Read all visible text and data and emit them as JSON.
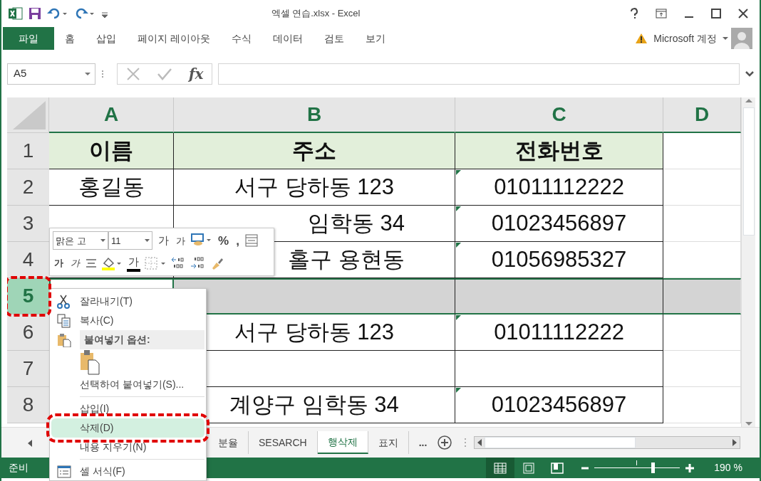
{
  "window": {
    "title": "엑셀 연습.xlsx - Excel"
  },
  "file_tab": "파일",
  "ribbon_tabs": [
    "홈",
    "삽입",
    "페이지 레이아웃",
    "수식",
    "데이터",
    "검토",
    "보기"
  ],
  "account": {
    "label": "Microsoft 계정"
  },
  "formula_bar": {
    "name_box": "A5",
    "fx": "fx"
  },
  "grid": {
    "columns": [
      {
        "label": "A",
        "selected": true
      },
      {
        "label": "B",
        "selected": true
      },
      {
        "label": "C",
        "selected": true
      },
      {
        "label": "D",
        "selected": true
      }
    ],
    "rows": [
      {
        "header": "1",
        "kind": "header",
        "selected": false,
        "marked": false,
        "cells": [
          {
            "text": "이름"
          },
          {
            "text": "주소"
          },
          {
            "text": "전화번호"
          },
          {}
        ]
      },
      {
        "header": "2",
        "kind": "data",
        "selected": false,
        "marked": false,
        "cells": [
          {
            "text": "홍길동"
          },
          {
            "text": "서구 당하동 123"
          },
          {
            "text": "01011112222",
            "flag": true
          },
          {}
        ]
      },
      {
        "header": "3",
        "kind": "data",
        "selected": false,
        "marked": false,
        "cells": [
          {},
          {
            "text": "임학동 34",
            "clipped": true
          },
          {
            "text": "01023456897",
            "flag": true
          },
          {}
        ]
      },
      {
        "header": "4",
        "kind": "data",
        "selected": false,
        "marked": false,
        "cells": [
          {},
          {
            "text": "홀구 용현동",
            "clipped": true
          },
          {
            "text": "01056985327",
            "flag": true
          },
          {}
        ]
      },
      {
        "header": "5",
        "kind": "data",
        "selected": true,
        "marked": true,
        "cells": [
          {
            "active": true
          },
          {
            "active": false
          },
          {
            "active": false
          },
          {
            "active": false
          }
        ]
      },
      {
        "header": "6",
        "kind": "data",
        "selected": false,
        "marked": false,
        "cells": [
          {},
          {
            "text": "서구 당하동 123"
          },
          {
            "text": "01011112222",
            "flag": true
          },
          {}
        ]
      },
      {
        "header": "7",
        "kind": "data",
        "selected": false,
        "marked": false,
        "cells": [
          {},
          {},
          {},
          {}
        ]
      },
      {
        "header": "8",
        "kind": "data",
        "selected": false,
        "marked": false,
        "cells": [
          {},
          {
            "text": "계양구 임학동 34"
          },
          {
            "text": "01023456897",
            "flag": true
          },
          {}
        ]
      }
    ]
  },
  "mini_toolbar": {
    "font": "맑은 고",
    "size": "11",
    "row1": [
      {
        "kind": "grow",
        "label": "가"
      },
      {
        "kind": "shrink",
        "label": "가"
      },
      {
        "kind": "accounting"
      },
      {
        "kind": "text",
        "label": "%"
      },
      {
        "kind": "text",
        "label": ","
      },
      {
        "kind": "format"
      }
    ],
    "row2": [
      {
        "kind": "bold",
        "label": "가"
      },
      {
        "kind": "italic",
        "label": "가"
      },
      {
        "kind": "align"
      },
      {
        "kind": "fill"
      },
      {
        "kind": "fontcolor",
        "label": "가"
      },
      {
        "kind": "borders"
      },
      {
        "kind": "incdec"
      },
      {
        "kind": "decdec"
      },
      {
        "kind": "painter"
      }
    ]
  },
  "context_menu": [
    {
      "kind": "cut",
      "label": "잘라내기(T)",
      "selected": false,
      "marked": false
    },
    {
      "kind": "copy",
      "label": "복사(C)",
      "selected": false,
      "marked": false
    },
    {
      "kind": "paste-header",
      "label": "붙여넣기 옵션:"
    },
    {
      "kind": "paste-option"
    },
    {
      "kind": "item",
      "label": "선택하여 붙여넣기(S)...",
      "selected": false,
      "marked": false
    },
    {
      "kind": "separator"
    },
    {
      "kind": "item",
      "label": "삽입(I)",
      "selected": false,
      "marked": false
    },
    {
      "kind": "item",
      "label": "삭제(D)",
      "selected": true,
      "marked": true
    },
    {
      "kind": "item",
      "label": "내용 지우기(N)",
      "selected": false,
      "marked": false
    },
    {
      "kind": "separator"
    },
    {
      "kind": "format",
      "label": "셀 서식(F)",
      "selected": false,
      "marked": false
    }
  ],
  "sheet_tabs": [
    {
      "label": "분율",
      "selected": false
    },
    {
      "label": "SESARCH",
      "selected": false
    },
    {
      "label": "행삭제",
      "selected": true
    },
    {
      "label": "표지",
      "selected": false
    }
  ],
  "sheet_more": "...",
  "status_bar": {
    "text": "준비",
    "views": [
      {
        "selected": true
      },
      {
        "selected": false
      },
      {
        "selected": false
      }
    ],
    "zoom": {
      "level": 0.68,
      "reading": "190 %"
    }
  }
}
